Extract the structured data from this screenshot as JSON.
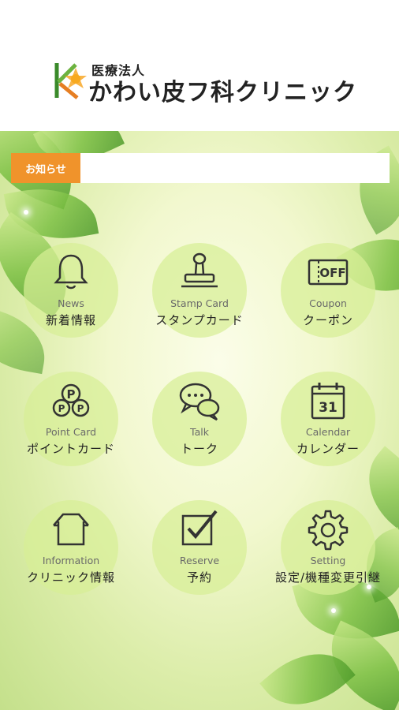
{
  "header": {
    "logo_subtitle": "医療法人",
    "logo_title": "かわい皮フ科クリニック",
    "logo_mark": "K-leaf-logo"
  },
  "news": {
    "label": "お知らせ",
    "text": ""
  },
  "menu": [
    {
      "en": "News",
      "ja": "新着情報",
      "icon": "bell-icon"
    },
    {
      "en": "Stamp Card",
      "ja": "スタンプカード",
      "icon": "stamp-icon"
    },
    {
      "en": "Coupon",
      "ja": "クーポン",
      "icon": "coupon-icon",
      "icon_text": "OFF"
    },
    {
      "en": "Point Card",
      "ja": "ポイントカード",
      "icon": "points-icon",
      "icon_text": "P"
    },
    {
      "en": "Talk",
      "ja": "トーク",
      "icon": "chat-icon"
    },
    {
      "en": "Calendar",
      "ja": "カレンダー",
      "icon": "calendar-icon",
      "icon_text": "31"
    },
    {
      "en": "Information",
      "ja": "クリニック情報",
      "icon": "house-icon"
    },
    {
      "en": "Reserve",
      "ja": "予約",
      "icon": "checkbox-icon"
    },
    {
      "en": "Setting",
      "ja": "設定/機種変更引継",
      "icon": "gear-icon"
    }
  ],
  "colors": {
    "accent": "#f0932b",
    "tile": "#d7ee96",
    "leaf": "#7cc044"
  }
}
